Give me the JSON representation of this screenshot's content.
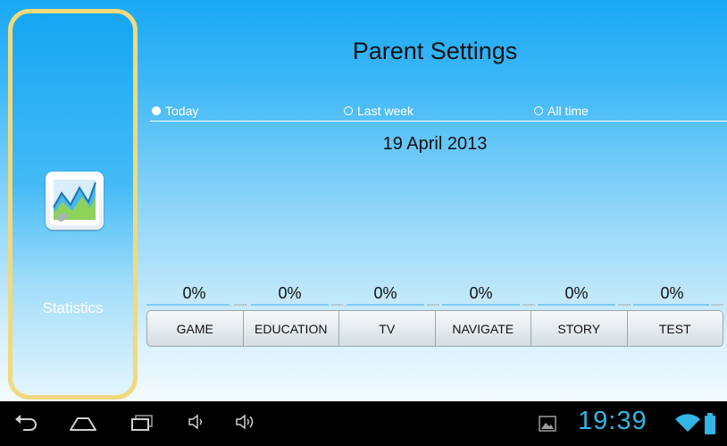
{
  "sidebar": {
    "statistics_label": "Statistics",
    "icon": "statistics-chart-icon"
  },
  "header": {
    "title": "Parent Settings"
  },
  "period_filter": {
    "options": [
      {
        "label": "Today",
        "selected": true
      },
      {
        "label": "Last week",
        "selected": false
      },
      {
        "label": "All time",
        "selected": false
      }
    ]
  },
  "date": "19 April 2013",
  "categories": [
    {
      "label": "GAME",
      "percent": "0%"
    },
    {
      "label": "EDUCATION",
      "percent": "0%"
    },
    {
      "label": "TV",
      "percent": "0%"
    },
    {
      "label": "NAVIGATE",
      "percent": "0%"
    },
    {
      "label": "STORY",
      "percent": "0%"
    },
    {
      "label": "TEST",
      "percent": "0%"
    }
  ],
  "system_bar": {
    "clock": "19:39",
    "icons": [
      "back-icon",
      "home-icon",
      "recent-apps-icon",
      "volume-down-icon",
      "volume-up-icon",
      "gallery-icon",
      "wifi-icon",
      "battery-icon"
    ],
    "accent_color": "#33b5e5"
  },
  "colors": {
    "sidebar_border": "#f1d97d",
    "sky_top": "#19a8f4",
    "sky_bottom": "#f4fbff"
  }
}
